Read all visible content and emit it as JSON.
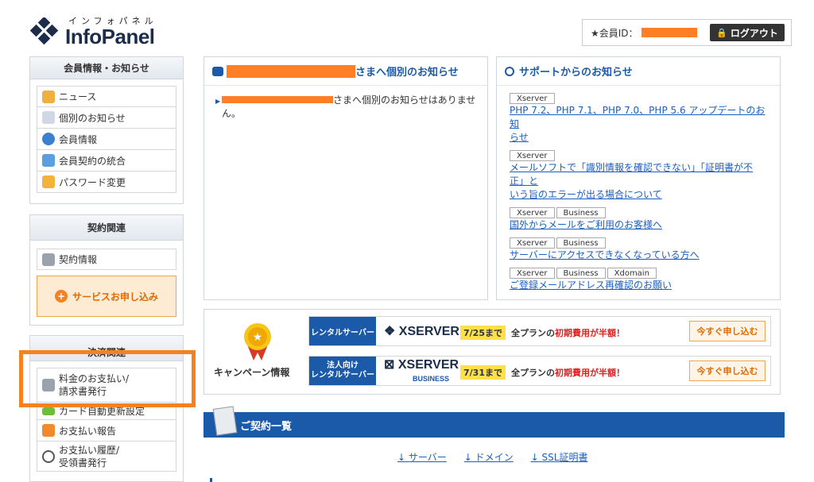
{
  "logo": {
    "kana": "インフォパネル",
    "word": "InfoPanel"
  },
  "member": {
    "id_label": "★会員ID：",
    "logout": "ログアウト"
  },
  "sidebar": {
    "member_section": {
      "title": "会員情報・お知らせ",
      "items": [
        "ニュース",
        "個別のお知らせ",
        "会員情報",
        "会員契約の統合",
        "パスワード変更"
      ]
    },
    "contract_section": {
      "title": "契約関連",
      "items": [
        "契約情報"
      ],
      "apply_button": "サービスお申し込み"
    },
    "payment_section": {
      "title": "決済関連",
      "items": [
        "料金のお支払い/",
        "請求書発行",
        "カード自動更新設定",
        "お支払い報告",
        "お支払い履歴/",
        "受領書発行"
      ]
    }
  },
  "notice": {
    "title_suffix": "さまへ個別のお知らせ",
    "body_suffix": "さまへ個別のお知らせはありませ",
    "body_line2": "ん。"
  },
  "support": {
    "title": "サポートからのお知らせ",
    "items": [
      {
        "tags": [
          "Xserver"
        ],
        "text_l1": "PHP 7.2、PHP 7.1、PHP 7.0、PHP 5.6 アップデートのお知",
        "text_l2": "らせ"
      },
      {
        "tags": [
          "Xserver"
        ],
        "text_l1": "メールソフトで「識別情報を確認できない」「証明書が不正」と",
        "text_l2": "いう旨のエラーが出る場合について"
      },
      {
        "tags": [
          "Xserver",
          "Business"
        ],
        "text_l1": "国外からメールをご利用のお客様へ",
        "text_l2": ""
      },
      {
        "tags": [
          "Xserver",
          "Business"
        ],
        "text_l1": "サーバーにアクセスできなくなっている方へ",
        "text_l2": ""
      },
      {
        "tags": [
          "Xserver",
          "Business",
          "Xdomain"
        ],
        "text_l1": "ご登録メールアドレス再確認のお願い",
        "text_l2": ""
      }
    ]
  },
  "campaign": {
    "label": "キャンペーン情報",
    "rows": [
      {
        "category": "レンタルサーバー",
        "brand": "XSERVER",
        "brand_sub": "",
        "deadline": "7/25まで",
        "text_a": "全プランの",
        "text_b": "初期費用が半額！",
        "button": "今すぐ申し込む"
      },
      {
        "category": "法人向け",
        "category2": "レンタルサーバー",
        "brand": "XSERVER",
        "brand_sub": "BUSINESS",
        "deadline": "7/31まで",
        "text_a": "全プランの",
        "text_b": "初期費用が半額！",
        "button": "今すぐ申し込む"
      }
    ]
  },
  "contracts": {
    "title": "ご契約一覧",
    "tabs": [
      "サーバー",
      "ドメイン",
      "SSL証明書"
    ]
  },
  "colors": {
    "accent": "#1b5aa8",
    "highlight": "#f58220",
    "redaction": "#ff7f27"
  }
}
